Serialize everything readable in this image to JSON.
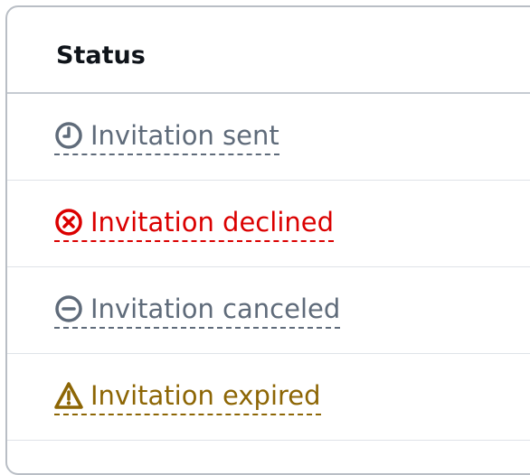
{
  "table": {
    "header": "Status",
    "rows": [
      {
        "label": "Invitation sent",
        "icon": "clock-icon",
        "type": "pending",
        "color": "#5f6b7a"
      },
      {
        "label": "Invitation declined",
        "icon": "error-circle-icon",
        "type": "error",
        "color": "#db0000"
      },
      {
        "label": "Invitation canceled",
        "icon": "stopped-circle-icon",
        "type": "stopped",
        "color": "#5f6b7a"
      },
      {
        "label": "Invitation expired",
        "icon": "warning-icon",
        "type": "warning",
        "color": "#8d6605"
      }
    ]
  }
}
